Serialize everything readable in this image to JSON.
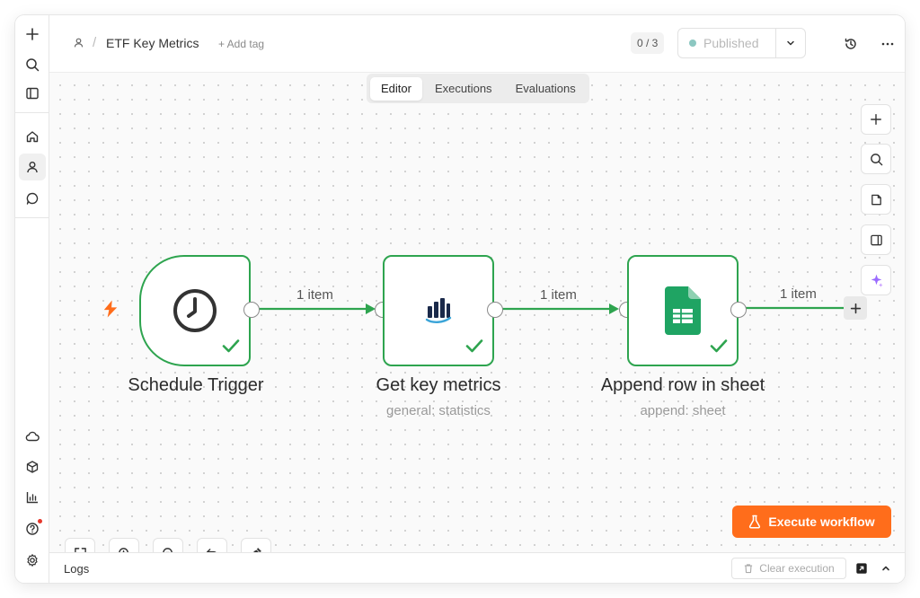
{
  "header": {
    "workflow_title": "ETF Key Metrics",
    "add_tag": "+ Add tag",
    "counter": "0 / 3",
    "publish_label": "Published"
  },
  "tabs": [
    {
      "label": "Editor",
      "active": true
    },
    {
      "label": "Executions",
      "active": false
    },
    {
      "label": "Evaluations",
      "active": false
    }
  ],
  "nodes": [
    {
      "title": "Schedule Trigger",
      "subtitle": "",
      "icon": "clock-icon",
      "status": "success"
    },
    {
      "title": "Get key metrics",
      "subtitle": "general: statistics",
      "icon": "stats-bars-icon",
      "status": "success"
    },
    {
      "title": "Append row in sheet",
      "subtitle": "append: sheet",
      "icon": "google-sheets-icon",
      "status": "success"
    }
  ],
  "edges": [
    {
      "label": "1 item"
    },
    {
      "label": "1 item"
    },
    {
      "label": "1 item"
    }
  ],
  "execute_button": "Execute workflow",
  "logs": {
    "title": "Logs",
    "clear_label": "Clear execution"
  },
  "colors": {
    "success_green": "#2ea44f",
    "accent_orange": "#ff6d1b",
    "sheets_green": "#1fa463"
  }
}
